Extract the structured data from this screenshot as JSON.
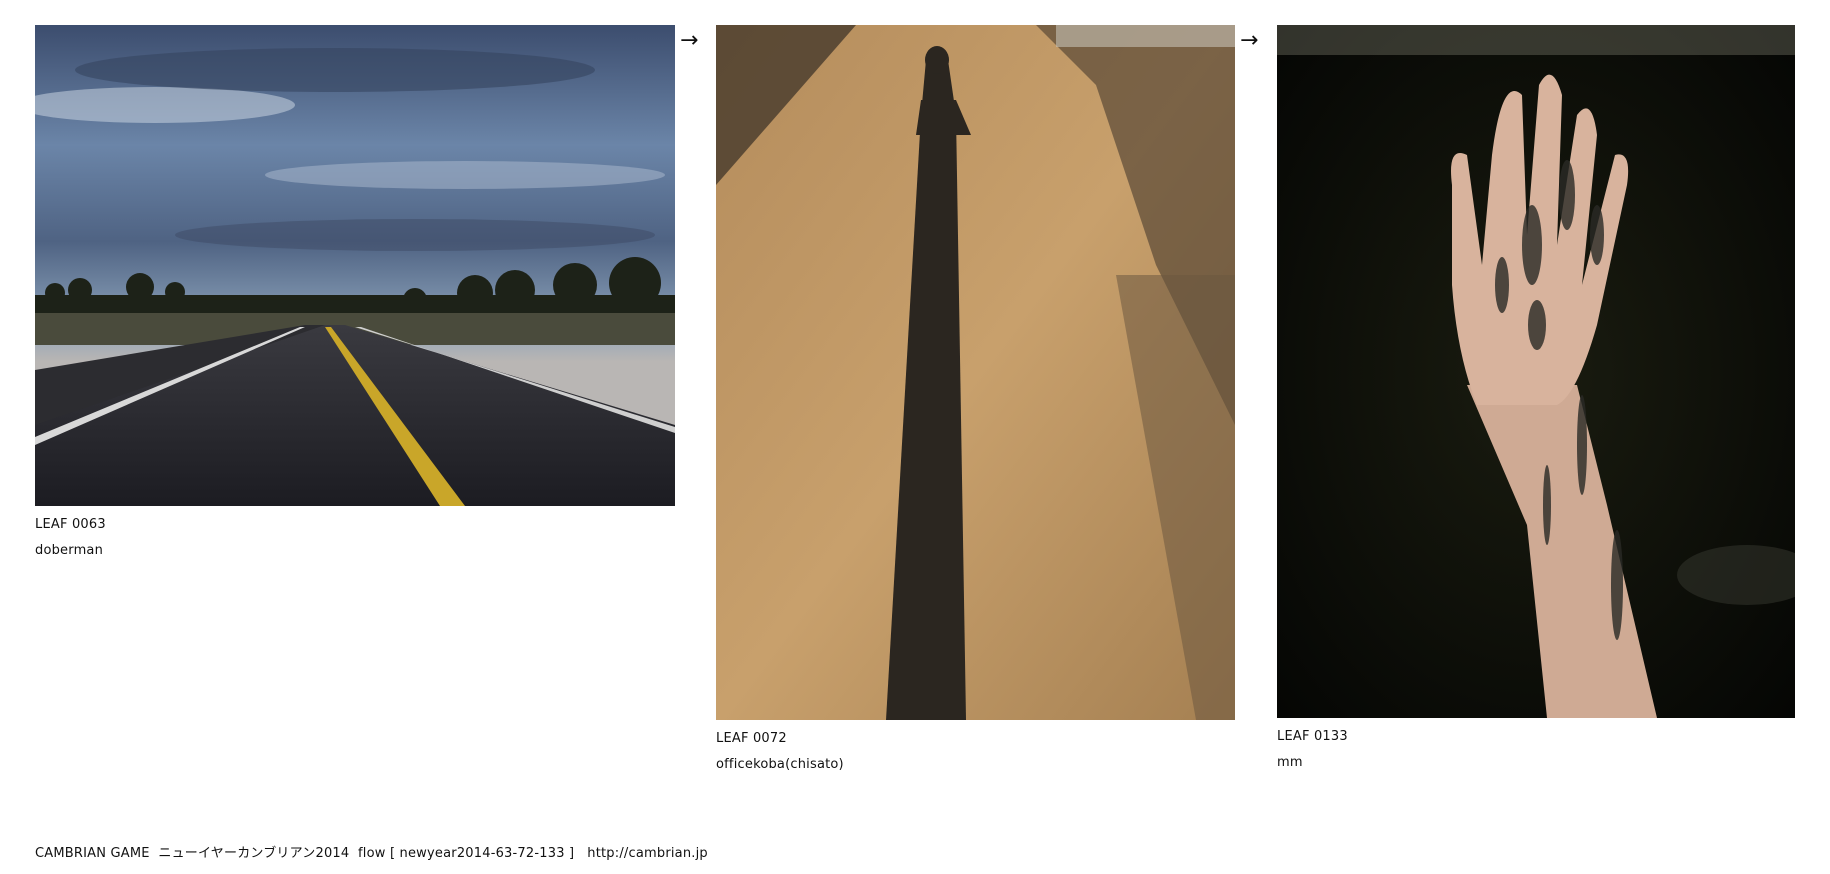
{
  "leaves": [
    {
      "id": "LEAF 0063",
      "author": "doberman",
      "image": "desert-highway-dusk-photo"
    },
    {
      "id": "LEAF 0072",
      "author": "officekoba(chisato)",
      "image": "long-shadow-on-sand-photo"
    },
    {
      "id": "LEAF 0133",
      "author": "mm",
      "image": "ink-stained-hand-photo"
    }
  ],
  "arrows": [
    "→",
    "→"
  ],
  "footer": {
    "text": "CAMBRIAN GAME  ニューイヤーカンブリアン2014  flow [ newyear2014-63-72-133 ]   http://cambrian.jp"
  }
}
